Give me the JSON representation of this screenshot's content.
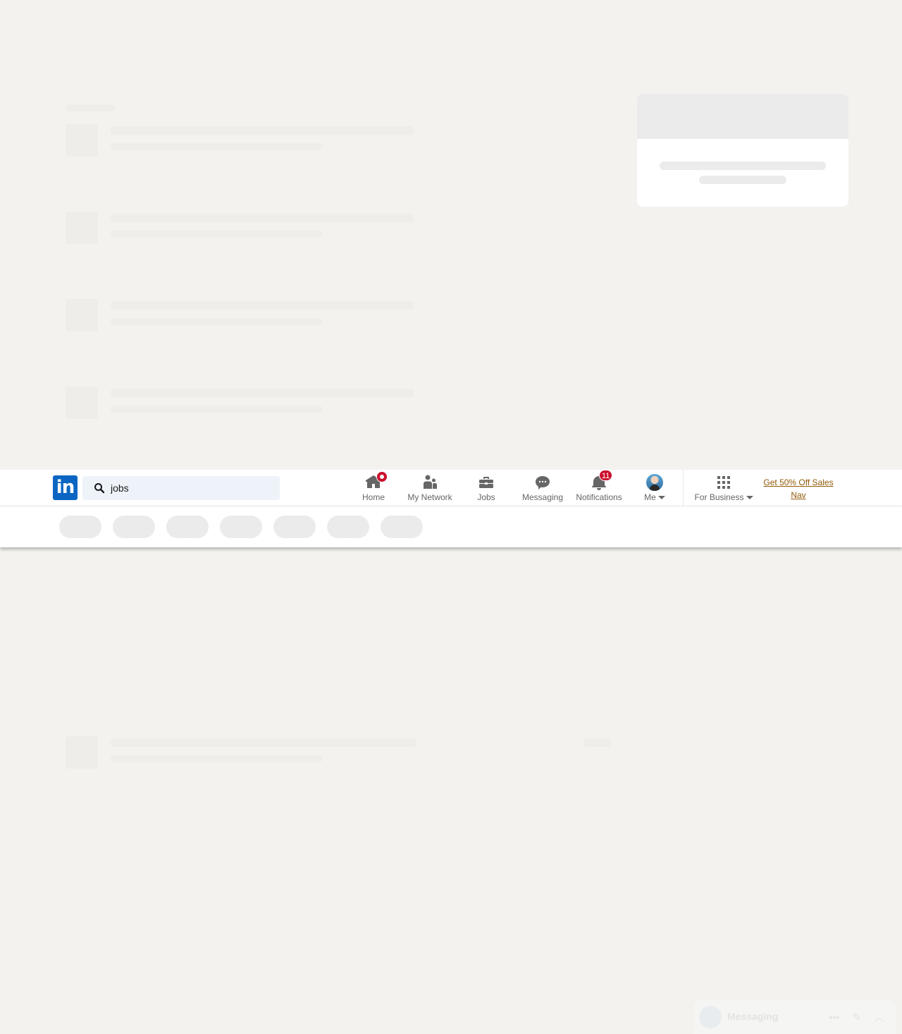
{
  "nav": {
    "logo_text": "in",
    "search": {
      "value": "jobs",
      "placeholder": "Search"
    },
    "items": [
      {
        "label": "Home",
        "icon": "home-icon",
        "badge": ""
      },
      {
        "label": "My Network",
        "icon": "people-icon",
        "badge": ""
      },
      {
        "label": "Jobs",
        "icon": "briefcase-icon",
        "badge": ""
      },
      {
        "label": "Messaging",
        "icon": "chat-icon",
        "badge": ""
      },
      {
        "label": "Notifications",
        "icon": "bell-icon",
        "badge": "11"
      },
      {
        "label": "Me",
        "icon": "avatar",
        "badge": ""
      },
      {
        "label": "For Business",
        "icon": "grid-icon",
        "badge": ""
      }
    ],
    "promo": "Get 50% Off Sales Nav"
  },
  "messaging_bar": {
    "label": "Messaging"
  },
  "colors": {
    "brand": "#0a66c2",
    "badge": "#cb112d",
    "promo": "#915907",
    "page_bg": "#f3f2ef",
    "skeleton": "#ebebeb"
  }
}
